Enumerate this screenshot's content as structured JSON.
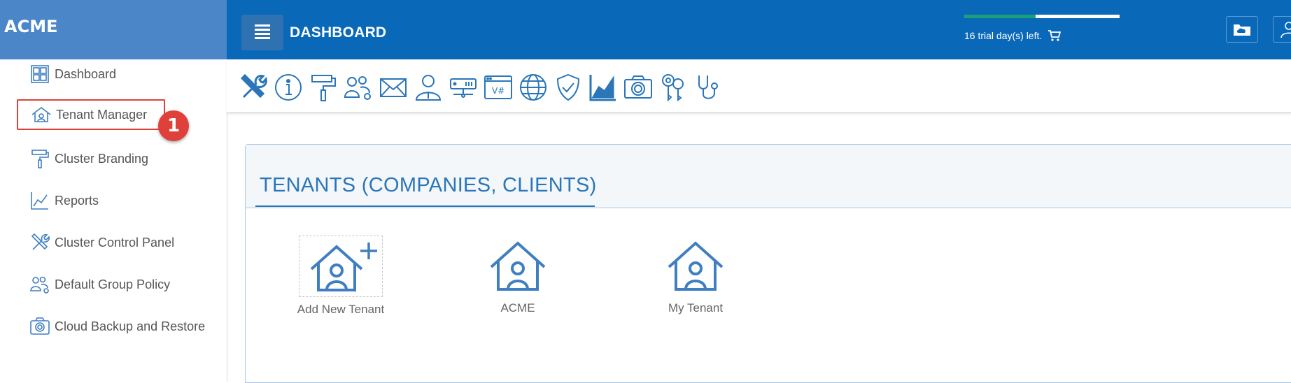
{
  "brand": "ACME",
  "sidebar": {
    "items": [
      {
        "label": "Dashboard",
        "icon": "dashboard-icon"
      },
      {
        "label": "Tenant Manager",
        "icon": "tenant-house-icon",
        "active": true
      },
      {
        "label": "Cluster Branding",
        "icon": "paint-roller-icon"
      },
      {
        "label": "Reports",
        "icon": "chart-icon"
      },
      {
        "label": "Cluster Control Panel",
        "icon": "tools-icon"
      },
      {
        "label": "Default Group Policy",
        "icon": "group-gear-icon"
      },
      {
        "label": "Cloud Backup and Restore",
        "icon": "camera-icon"
      }
    ],
    "annotation_badge": "1"
  },
  "header": {
    "title": "DASHBOARD",
    "trial_text": "16 trial day(s) left.",
    "trial_progress": 0.46,
    "colors": {
      "header_bg": "#0a68b8",
      "progress_fill": "#19a277"
    }
  },
  "toolbar": {
    "icons": [
      "tools-icon",
      "info-icon",
      "paint-roller-icon",
      "group-gear-icon",
      "mail-icon",
      "user-icon",
      "server-icon",
      "csharp-window-icon",
      "globe-icon",
      "shield-check-icon",
      "chart-icon",
      "camera-icon",
      "keys-icon",
      "stethoscope-icon"
    ]
  },
  "main": {
    "title": "TENANTS (COMPANIES, CLIENTS)",
    "tenants": [
      {
        "label": "Add New Tenant",
        "icon": "add-tenant-icon"
      },
      {
        "label": "ACME",
        "icon": "tenant-house-icon"
      },
      {
        "label": "My Tenant",
        "icon": "tenant-house-icon"
      }
    ]
  }
}
